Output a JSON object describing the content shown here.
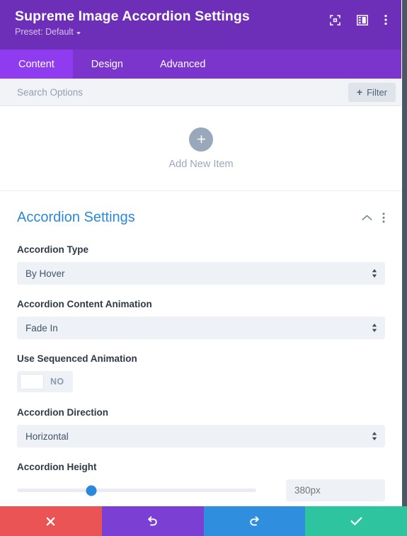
{
  "header": {
    "title": "Supreme Image Accordion Settings",
    "preset_label": "Preset: Default",
    "icons": [
      {
        "name": "focus-icon"
      },
      {
        "name": "layout-panel-icon"
      },
      {
        "name": "more-vertical-icon"
      }
    ]
  },
  "tabs": [
    {
      "label": "Content",
      "active": true
    },
    {
      "label": "Design",
      "active": false
    },
    {
      "label": "Advanced",
      "active": false
    }
  ],
  "search": {
    "value": "",
    "placeholder": "Search Options",
    "filter_label": "Filter",
    "filter_plus": "+"
  },
  "add_item": {
    "label": "Add New Item",
    "plus": "+"
  },
  "section": {
    "title": "Accordion Settings"
  },
  "fields": {
    "accordion_type": {
      "label": "Accordion Type",
      "value": "By Hover"
    },
    "content_animation": {
      "label": "Accordion Content Animation",
      "value": "Fade In"
    },
    "sequenced_animation": {
      "label": "Use Sequenced Animation",
      "state": "NO"
    },
    "direction": {
      "label": "Accordion Direction",
      "value": "Horizontal"
    },
    "height": {
      "label": "Accordion Height",
      "value": "",
      "placeholder": "380px",
      "slider_percent": 31
    }
  },
  "actions": [
    {
      "name": "cancel-button",
      "icon": "close-icon"
    },
    {
      "name": "undo-button",
      "icon": "undo-icon"
    },
    {
      "name": "redo-button",
      "icon": "redo-icon"
    },
    {
      "name": "save-button",
      "icon": "check-icon"
    }
  ],
  "colors": {
    "header_purple": "#6d2eb8",
    "tab_bar_purple": "#7b35cc",
    "tab_active_purple": "#8f3cf0",
    "accent_blue": "#2b87da",
    "cancel_red": "#ea5455",
    "undo_purple": "#7b3fd4",
    "redo_blue": "#2f8ede",
    "save_green": "#2ec4a0"
  }
}
